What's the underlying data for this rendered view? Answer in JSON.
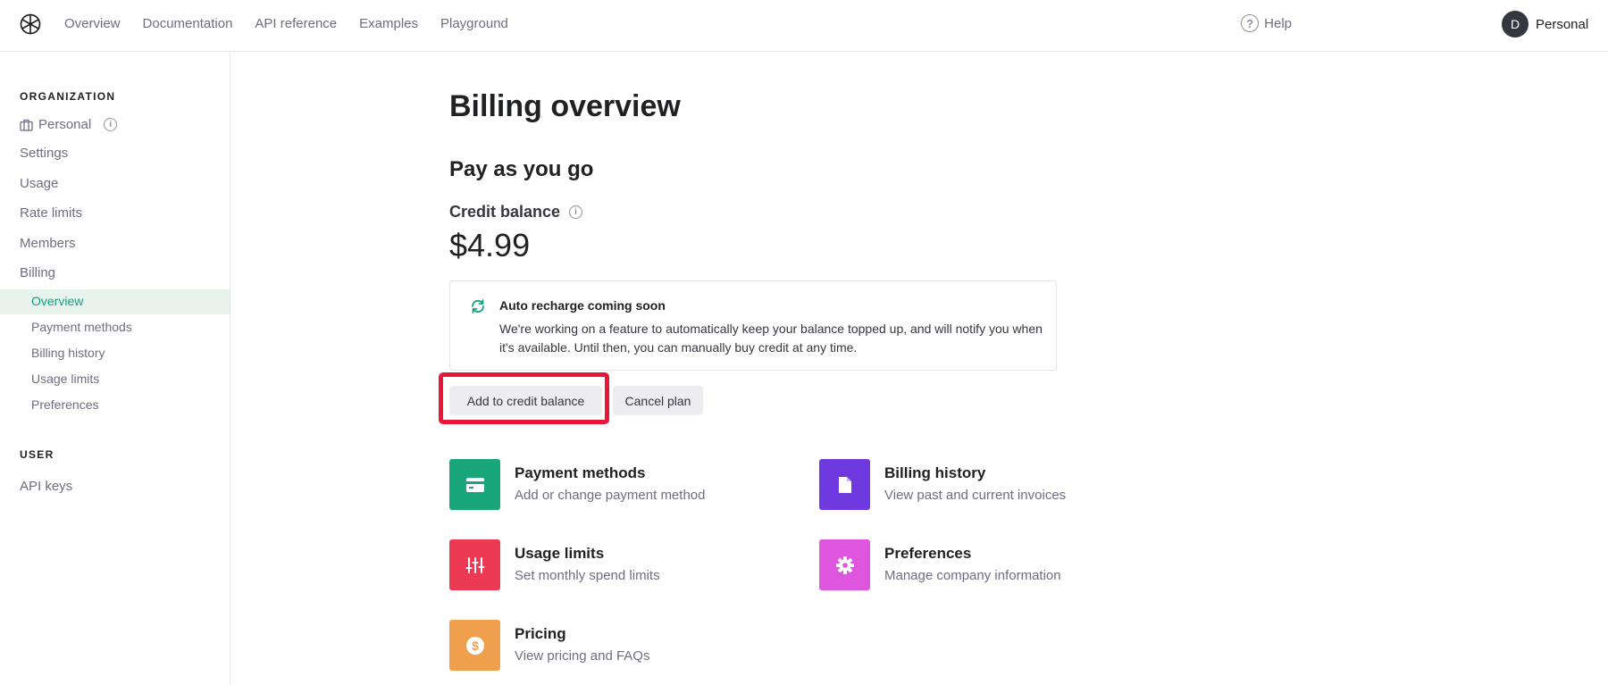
{
  "topnav": {
    "items": [
      "Overview",
      "Documentation",
      "API reference",
      "Examples",
      "Playground"
    ],
    "help_label": "Help",
    "avatar_initial": "D",
    "account_label": "Personal"
  },
  "sidebar": {
    "org_heading": "ORGANIZATION",
    "org_name": "Personal",
    "items": [
      "Settings",
      "Usage",
      "Rate limits",
      "Members",
      "Billing"
    ],
    "billing_sub": [
      "Overview",
      "Payment methods",
      "Billing history",
      "Usage limits",
      "Preferences"
    ],
    "user_heading": "USER",
    "user_items": [
      "API keys"
    ]
  },
  "main": {
    "title": "Billing overview",
    "plan_title": "Pay as you go",
    "credit_label": "Credit balance",
    "credit_value": "$4.99",
    "notice": {
      "title": "Auto recharge coming soon",
      "body": "We're working on a feature to automatically keep your balance topped up, and will notify you when it's available. Until then, you can manually buy credit at any time."
    },
    "add_credit_label": "Add to credit balance",
    "cancel_label": "Cancel plan",
    "cards": [
      {
        "title": "Payment methods",
        "desc": "Add or change payment method",
        "color": "#19a67a",
        "icon": "credit-card-icon"
      },
      {
        "title": "Billing history",
        "desc": "View past and current invoices",
        "color": "#6e3adf",
        "icon": "document-icon"
      },
      {
        "title": "Usage limits",
        "desc": "Set monthly spend limits",
        "color": "#ec3a55",
        "icon": "sliders-icon"
      },
      {
        "title": "Preferences",
        "desc": "Manage company information",
        "color": "#dd56dd",
        "icon": "gear-icon"
      },
      {
        "title": "Pricing",
        "desc": "View pricing and FAQs",
        "color": "#f0a04c",
        "icon": "dollar-icon"
      }
    ]
  },
  "colors": {
    "accent": "#10a37f",
    "highlight": "#e8173a"
  }
}
